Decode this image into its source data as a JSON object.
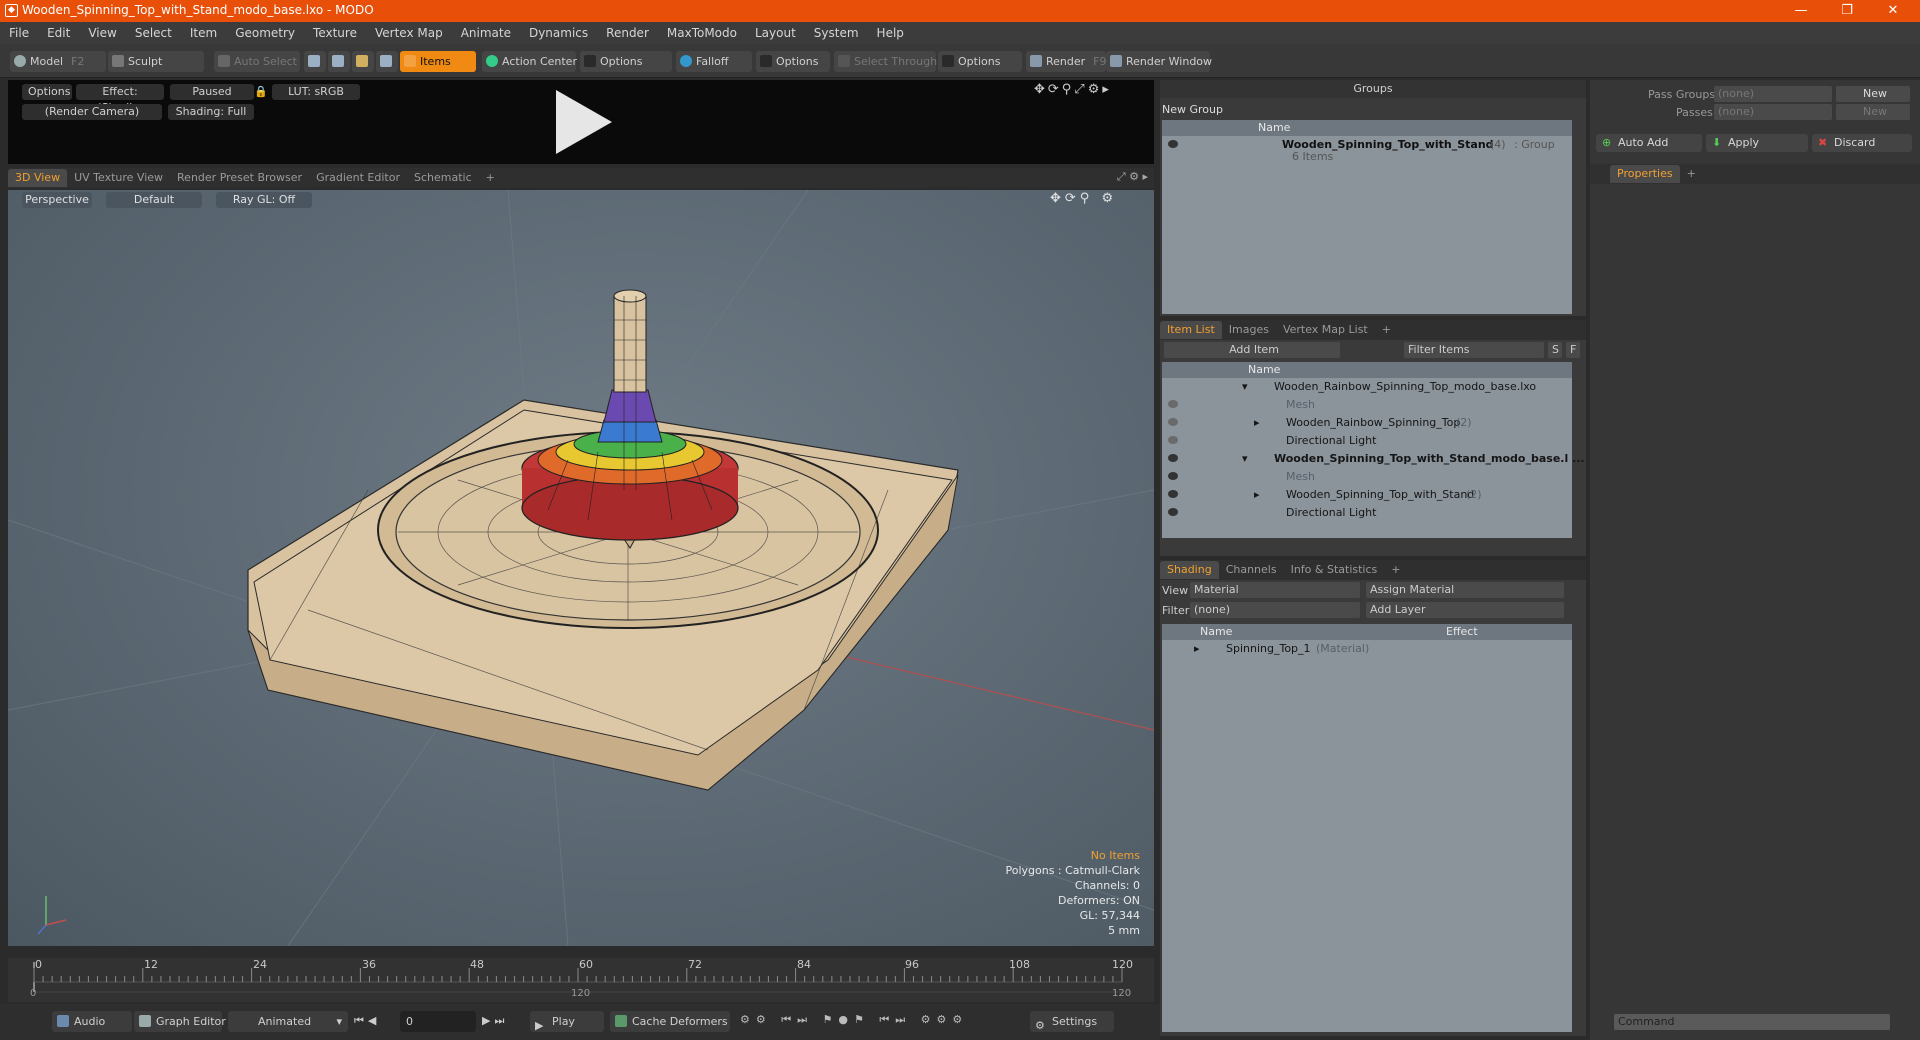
{
  "window": {
    "title": "Wooden_Spinning_Top_with_Stand_modo_base.lxo - MODO",
    "minimize": "—",
    "maximize": "❐",
    "close": "✕"
  },
  "menu": [
    "File",
    "Edit",
    "View",
    "Select",
    "Item",
    "Geometry",
    "Texture",
    "Vertex Map",
    "Animate",
    "Dynamics",
    "Render",
    "MaxToModo",
    "Layout",
    "System",
    "Help"
  ],
  "toolbar": {
    "model": "Model",
    "model_key": "F2",
    "sculpt": "Sculpt",
    "auto_select": "Auto Select",
    "items": "Items",
    "action_center": "Action Center",
    "options1": "Options",
    "falloff": "Falloff",
    "options2": "Options",
    "select_through": "Select Through",
    "options3": "Options",
    "render": "Render",
    "render_key": "F9",
    "render_window": "Render Window"
  },
  "preview": {
    "options": "Options",
    "effect": "Effect: (Shadi...",
    "paused": "Paused",
    "lut": "LUT: sRGB",
    "camera": "(Render Camera)",
    "shading": "Shading: Full"
  },
  "viewport_tabs": [
    "3D View",
    "UV Texture View",
    "Render Preset Browser",
    "Gradient Editor",
    "Schematic",
    "+"
  ],
  "viewport": {
    "perspective": "Perspective",
    "default": "Default",
    "raygl": "Ray GL: Off",
    "info": {
      "no_items": "No Items",
      "polygons": "Polygons : Catmull-Clark",
      "channels": "Channels: 0",
      "deformers": "Deformers: ON",
      "gl": "GL: 57,344",
      "scale": "5 mm"
    }
  },
  "timeline": {
    "ticks": [
      "0",
      "12",
      "24",
      "36",
      "48",
      "60",
      "72",
      "84",
      "96",
      "108",
      "120"
    ],
    "start": "0",
    "mid": "120",
    "end": "120"
  },
  "bottombar": {
    "audio": "Audio",
    "graph_editor": "Graph Editor",
    "animated": "Animated",
    "frame": "0",
    "play": "Play",
    "cache_deformers": "Cache Deformers",
    "settings": "Settings"
  },
  "groups": {
    "header": "Groups",
    "new_group": "New Group",
    "col_name": "Name",
    "item_name": "Wooden_Spinning_Top_with_Stand",
    "item_count": "(4)",
    "item_type": ": Group",
    "item_sub": "6 Items"
  },
  "itemlist": {
    "tabs": [
      "Item List",
      "Images",
      "Vertex Map List",
      "+"
    ],
    "add_item": "Add Item",
    "filter": "Filter Items",
    "s": "S",
    "f": "F",
    "col_name": "Name",
    "rows": [
      {
        "label": "Wooden_Rainbow_Spinning_Top_modo_base.lxo",
        "count": "",
        "style": "scene"
      },
      {
        "label": "Mesh",
        "count": "",
        "style": "muted"
      },
      {
        "label": "Wooden_Rainbow_Spinning_Top",
        "count": "(2)",
        "style": "item"
      },
      {
        "label": "Directional Light",
        "count": "",
        "style": "item"
      },
      {
        "label": "Wooden_Spinning_Top_with_Stand_modo_base.l ...",
        "count": "",
        "style": "scene-bold"
      },
      {
        "label": "Mesh",
        "count": "",
        "style": "muted"
      },
      {
        "label": "Wooden_Spinning_Top_with_Stand",
        "count": "(2)",
        "style": "item"
      },
      {
        "label": "Directional Light",
        "count": "",
        "style": "item"
      }
    ]
  },
  "shading": {
    "tabs": [
      "Shading",
      "Channels",
      "Info & Statistics",
      "+"
    ],
    "view_label": "View",
    "view_value": "Material",
    "assign": "Assign Material",
    "filter_label": "Filter",
    "filter_value": "(none)",
    "add_layer": "Add Layer",
    "col_name": "Name",
    "col_effect": "Effect",
    "row_name": "Spinning_Top_1",
    "row_type": "(Material)"
  },
  "right": {
    "pass_groups": "Pass Groups",
    "passes": "Passes",
    "none1": "(none)",
    "none2": "(none)",
    "new1": "New",
    "new2": "New",
    "auto_add": "Auto Add",
    "apply": "Apply",
    "discard": "Discard",
    "properties": "Properties",
    "plus": "+",
    "command": "Command"
  },
  "colors": {
    "accent": "#f08a12",
    "titlebar": "#e8500a"
  }
}
